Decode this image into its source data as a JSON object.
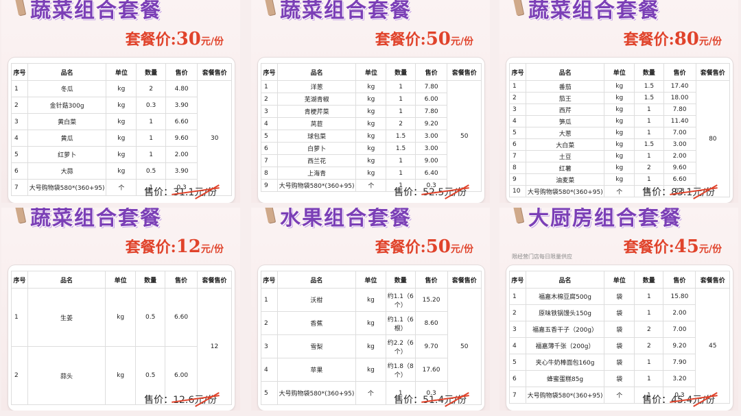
{
  "panels": [
    {
      "title": "蔬菜组合套餐",
      "price_label": "套餐价:",
      "price_value": "30",
      "price_unit": "元/份",
      "note": "",
      "headers": [
        "序号",
        "品名",
        "单位",
        "数量",
        "售价",
        "套餐售价"
      ],
      "rows": [
        [
          "1",
          "冬瓜",
          "kg",
          "2",
          "4.80"
        ],
        [
          "2",
          "金针菇300g",
          "kg",
          "0.3",
          "3.90"
        ],
        [
          "3",
          "黄白菜",
          "kg",
          "1",
          "6.60"
        ],
        [
          "4",
          "黄瓜",
          "kg",
          "1",
          "9.60"
        ],
        [
          "5",
          "红萝卜",
          "kg",
          "1",
          "2.00"
        ],
        [
          "6",
          "大蒜",
          "kg",
          "0.5",
          "3.90"
        ],
        [
          "7",
          "大号购物袋580*(360+95)",
          "个",
          "1",
          "0.3"
        ]
      ],
      "set_price": "30",
      "sale_label": "售价：",
      "sale_value": "31.1元/份"
    },
    {
      "title": "蔬菜组合套餐",
      "price_label": "套餐价:",
      "price_value": "50",
      "price_unit": "元/份",
      "note": "",
      "headers": [
        "序号",
        "品名",
        "单位",
        "数量",
        "售价",
        "套餐售价"
      ],
      "rows": [
        [
          "1",
          "洋葱",
          "kg",
          "1",
          "7.80"
        ],
        [
          "2",
          "芜湖青椒",
          "kg",
          "1",
          "6.00"
        ],
        [
          "3",
          "青梗芹菜",
          "kg",
          "1",
          "7.80"
        ],
        [
          "4",
          "莴苣",
          "kg",
          "2",
          "9.20"
        ],
        [
          "5",
          "球包菜",
          "kg",
          "1.5",
          "3.00"
        ],
        [
          "6",
          "白萝卜",
          "kg",
          "1.5",
          "3.00"
        ],
        [
          "7",
          "西兰花",
          "kg",
          "1",
          "9.00"
        ],
        [
          "8",
          "上海青",
          "kg",
          "1",
          "6.40"
        ],
        [
          "9",
          "大号购物袋580*(360+95)",
          "个",
          "1",
          "0.3"
        ]
      ],
      "set_price": "50",
      "sale_label": "售价：",
      "sale_value": "52.5元/份"
    },
    {
      "title": "蔬菜组合套餐",
      "price_label": "套餐价:",
      "price_value": "80",
      "price_unit": "元/份",
      "note": "",
      "headers": [
        "序号",
        "品名",
        "单位",
        "数量",
        "售价",
        "套餐售价"
      ],
      "rows": [
        [
          "1",
          "番茄",
          "kg",
          "1.5",
          "17.40"
        ],
        [
          "2",
          "茄王",
          "kg",
          "1.5",
          "18.00"
        ],
        [
          "3",
          "西芹",
          "kg",
          "1",
          "7.80"
        ],
        [
          "4",
          "笋瓜",
          "kg",
          "1",
          "11.40"
        ],
        [
          "5",
          "大葱",
          "kg",
          "1",
          "7.00"
        ],
        [
          "6",
          "大白菜",
          "kg",
          "1.5",
          "3.00"
        ],
        [
          "7",
          "土豆",
          "kg",
          "1",
          "2.00"
        ],
        [
          "8",
          "红薯",
          "kg",
          "2",
          "9.60"
        ],
        [
          "9",
          "油麦菜",
          "kg",
          "1",
          "6.60"
        ],
        [
          "10",
          "大号购物袋580*(360+95)",
          "个",
          "1",
          "0.3"
        ]
      ],
      "set_price": "80",
      "sale_label": "售价：",
      "sale_value": "83.1元/份"
    },
    {
      "title": "蔬菜组合套餐",
      "price_label": "套餐价:",
      "price_value": "12",
      "price_unit": "元/份",
      "note": "",
      "headers": [
        "序号",
        "品名",
        "单位",
        "数量",
        "售价",
        "套餐售价"
      ],
      "rows": [
        [
          "1",
          "生姜",
          "kg",
          "0.5",
          "6.60"
        ],
        [
          "2",
          "蒜头",
          "kg",
          "0.5",
          "6.00"
        ]
      ],
      "set_price": "12",
      "sale_label": "售价：",
      "sale_value": "12.6元/份"
    },
    {
      "title": "水果组合套餐",
      "price_label": "套餐价:",
      "price_value": "50",
      "price_unit": "元/份",
      "note": "",
      "headers": [
        "序号",
        "品名",
        "单位",
        "数量",
        "售价",
        "套餐售价"
      ],
      "rows": [
        [
          "1",
          "沃柑",
          "kg",
          "约1.1（6个）",
          "15.20"
        ],
        [
          "2",
          "香蕉",
          "kg",
          "约1.1（6根）",
          "8.60"
        ],
        [
          "3",
          "雪梨",
          "kg",
          "约2.2（6个）",
          "9.70"
        ],
        [
          "4",
          "苹果",
          "kg",
          "约1.8（8个）",
          "17.60"
        ],
        [
          "5",
          "大号购物袋580*(360+95)",
          "个",
          "1",
          "0.3"
        ]
      ],
      "set_price": "50",
      "sale_label": "售价：",
      "sale_value": "51.4元/份"
    },
    {
      "title": "大厨房组合套餐",
      "price_label": "套餐价:",
      "price_value": "45",
      "price_unit": "元/份",
      "note": "限经营门店每日限量供应",
      "headers": [
        "序号",
        "品名",
        "单位",
        "数量",
        "售价",
        "套餐售价"
      ],
      "rows": [
        [
          "1",
          "福嘉木棉豆腐500g",
          "袋",
          "1",
          "15.80"
        ],
        [
          "2",
          "原味铁锅馒头150g",
          "袋",
          "1",
          "2.00"
        ],
        [
          "3",
          "福嘉五香干子（200g）",
          "袋",
          "2",
          "7.00"
        ],
        [
          "4",
          "福嘉薄千张（200g）",
          "袋",
          "2",
          "9.20"
        ],
        [
          "5",
          "夹心牛奶棒面包160g",
          "袋",
          "1",
          "7.90"
        ],
        [
          "6",
          "蜂蜜蛋糕85g",
          "袋",
          "1",
          "3.20"
        ],
        [
          "7",
          "大号购物袋580*(360+95)",
          "个",
          "1",
          "0.3"
        ]
      ],
      "set_price": "45",
      "sale_label": "售价：",
      "sale_value": "45.4元/份"
    }
  ]
}
